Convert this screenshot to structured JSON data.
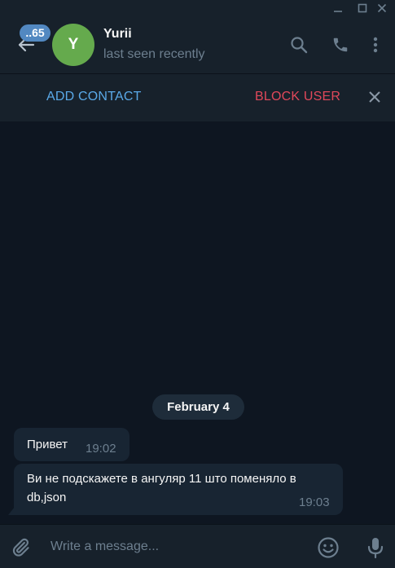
{
  "window": {
    "controls": [
      "minimize-icon",
      "maximize-icon",
      "close-icon"
    ]
  },
  "header": {
    "unread_count": "..65",
    "avatar_initial": "Y",
    "avatar_color": "#65aa4d",
    "name": "Yurii",
    "status": "last seen recently",
    "icons": [
      "back-arrow-icon",
      "search-icon",
      "phone-icon",
      "more-vertical-icon"
    ]
  },
  "action_bar": {
    "add_contact": "ADD CONTACT",
    "block_user": "BLOCK USER",
    "add_contact_color": "#5aa9e8",
    "block_user_color": "#e0485a"
  },
  "messages": {
    "date_separator": "February 4",
    "items": [
      {
        "text": "Привет",
        "time": "19:02"
      },
      {
        "text_line1": "Ви не подскажете в ангуляр 11 што поменяло в",
        "text_line2": "db,json",
        "time": "19:03"
      }
    ]
  },
  "composer": {
    "placeholder": "Write a message...",
    "icons": [
      "paperclip-icon",
      "emoji-icon",
      "microphone-icon"
    ]
  },
  "colors": {
    "background": "#0e1621",
    "panel": "#17212b",
    "bubble": "#182533",
    "accent": "#5288c1"
  }
}
